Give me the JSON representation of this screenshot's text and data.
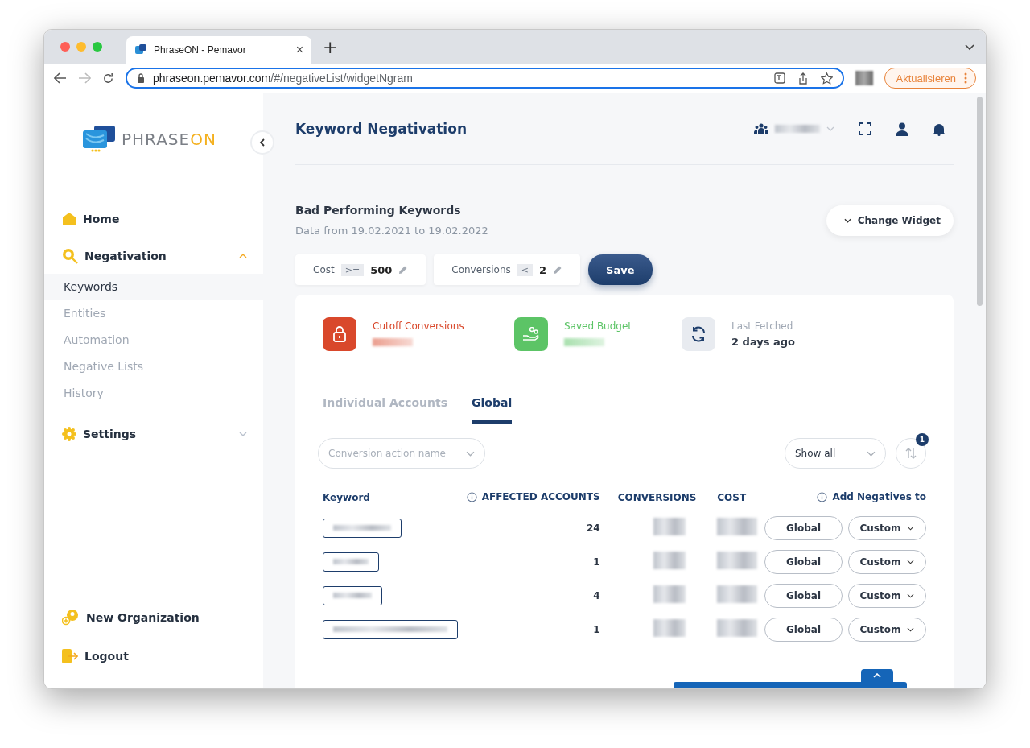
{
  "browser": {
    "tab_title": "PhraseON - Pemavor",
    "tab_close": "×",
    "new_tab": "+",
    "url_host": "phraseon.pemavor.com",
    "url_path": "/#/negativeList/widgetNgram",
    "update_button": "Aktualisieren"
  },
  "sidebar": {
    "logo": {
      "part_a": "PHRASE",
      "part_b": "ON"
    },
    "items": [
      {
        "label": "Home",
        "kind": "home"
      },
      {
        "label": "Negativation",
        "kind": "search",
        "expanded": true,
        "children": [
          {
            "label": "Keywords",
            "selected": true
          },
          {
            "label": "Entities",
            "selected": false
          },
          {
            "label": "Automation",
            "selected": false
          },
          {
            "label": "Negative Lists",
            "selected": false
          },
          {
            "label": "History",
            "selected": false
          }
        ]
      },
      {
        "label": "Settings",
        "kind": "gear",
        "expanded": false
      }
    ],
    "bottom_items": [
      {
        "label": "New Organization",
        "kind": "org"
      },
      {
        "label": "Logout",
        "kind": "logout"
      }
    ]
  },
  "header": {
    "title": "Keyword Negativation"
  },
  "widget": {
    "title": "Bad Performing Keywords",
    "subtitle": "Data from 19.02.2021 to 19.02.2022",
    "change_button": "Change Widget",
    "filters": [
      {
        "label": "Cost",
        "operator": ">=",
        "value": "500"
      },
      {
        "label": "Conversions",
        "operator": "<",
        "value": "2"
      }
    ],
    "save_button": "Save"
  },
  "stats": [
    {
      "label": "Cutoff Conversions",
      "kind": "lock",
      "color": "#d9482b"
    },
    {
      "label": "Saved Budget",
      "kind": "hand",
      "color": "#5cc466"
    },
    {
      "label": "Last Fetched",
      "kind": "refresh",
      "color": "#e8ebf0",
      "value": "2 days ago"
    }
  ],
  "tabs": [
    {
      "label": "Individual Accounts",
      "selected": false
    },
    {
      "label": "Global",
      "selected": true
    }
  ],
  "conversion_select": {
    "placeholder": "Conversion action name"
  },
  "show_select": {
    "value": "Show all"
  },
  "sort_badge": "1",
  "table": {
    "columns": [
      {
        "label": "Keyword",
        "info": false
      },
      {
        "label": "AFFECTED ACCOUNTS",
        "info": true
      },
      {
        "label": "CONVERSIONS",
        "info": false
      },
      {
        "label": "COST",
        "info": false
      },
      {
        "label": "Add Negatives to",
        "info": true
      }
    ],
    "rows": [
      {
        "accounts": "24",
        "global_button": "Global",
        "custom_button": "Custom"
      },
      {
        "accounts": "1",
        "global_button": "Global",
        "custom_button": "Custom"
      },
      {
        "accounts": "4",
        "global_button": "Global",
        "custom_button": "Custom"
      },
      {
        "accounts": "1",
        "global_button": "Global",
        "custom_button": "Custom"
      }
    ]
  }
}
